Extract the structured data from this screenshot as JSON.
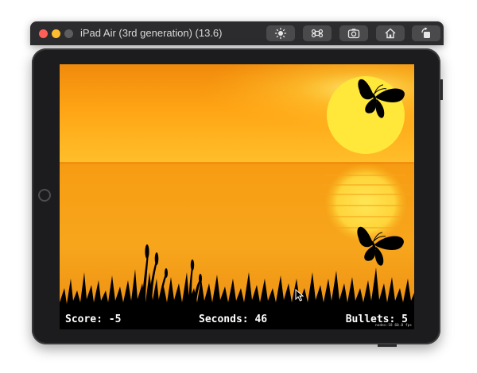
{
  "window": {
    "title": "iPad Air (3rd generation) (13.6)",
    "traffic_lights": [
      "#ff5f57",
      "#febc2e",
      "#5d5d60"
    ],
    "toolbar": [
      {
        "icon": "brightness-icon"
      },
      {
        "icon": "command-icon"
      },
      {
        "icon": "screenshot-camera-icon"
      },
      {
        "icon": "home-icon"
      },
      {
        "icon": "rotate-icon"
      }
    ]
  },
  "game": {
    "hud": {
      "score": "Score: -5",
      "seconds": "Seconds: 46",
      "bullets": "Bullets: 5"
    },
    "debug_stats": "nodes:18  60.0 fps",
    "colors": {
      "sky_top": "#f08a0c",
      "sky_mid": "#ffb21f",
      "sun": "#ffe83a",
      "water": "#f7a11a",
      "silhouette": "#000000"
    },
    "sprites": [
      "butterfly",
      "butterfly"
    ]
  }
}
